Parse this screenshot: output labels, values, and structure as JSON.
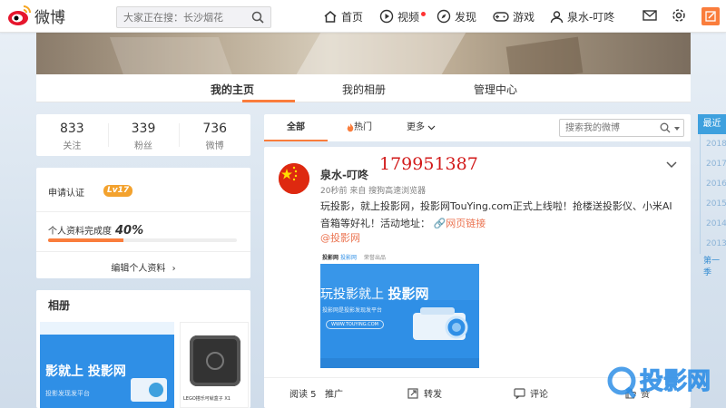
{
  "nav": {
    "logo_text": "微博",
    "search_placeholder": "大家正在搜：长沙烟花",
    "home": "首页",
    "video": "视频",
    "discover": "发现",
    "game": "游戏",
    "username": "泉水-叮咚"
  },
  "profile_tabs": {
    "home": "我的主页",
    "album": "我的相册",
    "manage": "管理中心"
  },
  "stats": [
    {
      "num": "833",
      "label": "关注"
    },
    {
      "num": "339",
      "label": "粉丝"
    },
    {
      "num": "736",
      "label": "微博"
    }
  ],
  "profile": {
    "verify": "申请认证",
    "level": "Lv17",
    "complete_label": "个人资料完成度",
    "complete_pct": "40%",
    "complete_value": 0.4,
    "edit": "编辑个人资料"
  },
  "album": {
    "title": "相册",
    "img1_text": "影就上 投影网",
    "img1_sub": "投影发现发平台",
    "img2_caption": "LEGO搭乐可就盒子 X1"
  },
  "feed_filter": {
    "all": "全部",
    "hot": "热门",
    "more": "更多",
    "search_placeholder": "搜索我的微博"
  },
  "post": {
    "user": "泉水-叮咚",
    "number": "179951387",
    "meta": "20秒前 来自 搜狗高速浏览器",
    "text": "玩投影，就上投影网，投影网TouYing.com正式上线啦！抢楼送投影仪、小米AI音箱等好礼！活动地址：",
    "link": "网页链接",
    "at": "@投影网",
    "image_title_a": "玩投影就上 ",
    "image_title_b": "投影网",
    "image_sub1": "投影网是投影发现发平台",
    "image_url": "WWW.TOUYING.COM",
    "image_brand1": "投影网",
    "image_brand2": "投影网",
    "image_brand3": "荣誉出品",
    "reads": "阅读 5",
    "promote": "推广",
    "repost": "转发",
    "comment": "评论",
    "like": "赞"
  },
  "timeline": {
    "recent": "最近",
    "years": [
      "2018",
      "2017",
      "2016",
      "2015",
      "2014",
      "2013"
    ],
    "more": "第一季"
  },
  "watermark": "投影网",
  "colors": {
    "accent": "#fa7d3c",
    "link": "#eb7350",
    "timeline": "#3ea0de",
    "red_number": "#d21a1a"
  }
}
